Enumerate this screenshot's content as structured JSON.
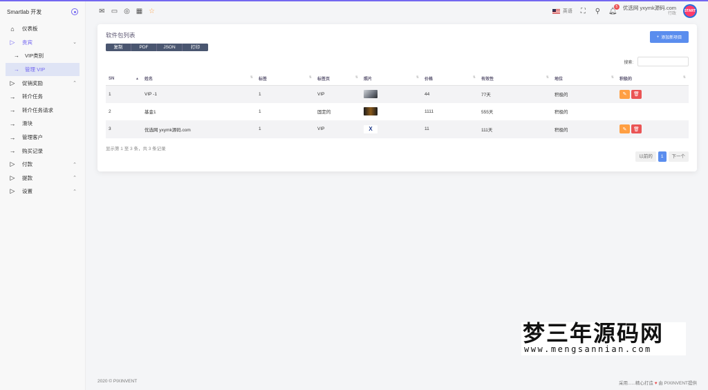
{
  "brand": {
    "name": "Smartlab 开发"
  },
  "sidebar": {
    "items": [
      {
        "icon": "home-icon",
        "glyph": "⌂",
        "label": "仪表板",
        "chev": ""
      },
      {
        "icon": "play-icon",
        "glyph": "▷",
        "label": "贵宾",
        "chev": "⌄"
      },
      {
        "icon": "arrow-icon",
        "glyph": "→",
        "label": "VIP类别",
        "chev": ""
      },
      {
        "icon": "arrow-icon",
        "glyph": "→",
        "label": "管理 VIP",
        "chev": ""
      },
      {
        "icon": "play-icon",
        "glyph": "▷",
        "label": "促销奖励",
        "chev": "⌃"
      },
      {
        "icon": "arrow-icon",
        "glyph": "→",
        "label": "转介任务",
        "chev": ""
      },
      {
        "icon": "arrow-icon",
        "glyph": "→",
        "label": "转介任务请求",
        "chev": ""
      },
      {
        "icon": "arrow-icon",
        "glyph": "→",
        "label": "滑块",
        "chev": ""
      },
      {
        "icon": "arrow-icon",
        "glyph": "→",
        "label": "管理客户",
        "chev": ""
      },
      {
        "icon": "arrow-icon",
        "glyph": "→",
        "label": "购买记录",
        "chev": ""
      },
      {
        "icon": "play-icon",
        "glyph": "▷",
        "label": "付款",
        "chev": "⌃"
      },
      {
        "icon": "play-icon",
        "glyph": "▷",
        "label": "提款",
        "chev": "⌃"
      },
      {
        "icon": "play-icon",
        "glyph": "▷",
        "label": "设置",
        "chev": "⌃"
      }
    ]
  },
  "header": {
    "lang": "英语",
    "notif_count": "5",
    "user_name": "优选网 yxymk源码.com",
    "user_role": "行政",
    "avatar_text": "START"
  },
  "card": {
    "title": "软件包列表",
    "export": [
      "复制",
      "PDF",
      "JSON",
      "打印"
    ],
    "add_label": "添加新项目",
    "search_label": "搜索:",
    "columns": [
      "SN",
      "姓名",
      "标签",
      "标签页",
      "照片",
      "价格",
      "有效性",
      "地位",
      "积极的"
    ],
    "rows": [
      {
        "sn": "1",
        "name": "VIP -1",
        "tag": "1",
        "tab": "VIP",
        "photo": "car",
        "price": "44",
        "validity": "77天",
        "status": "积极的"
      },
      {
        "sn": "2",
        "name": "基金1",
        "tag": "1",
        "tab": "固定的",
        "photo": "dark",
        "price": "1111",
        "validity": "555天",
        "status": "积极的"
      },
      {
        "sn": "3",
        "name": "优选网 yxymk源码.com",
        "tag": "1",
        "tab": "VIP",
        "photo": "logo",
        "price": "11",
        "validity": "111天",
        "status": "积极的"
      }
    ],
    "info": "显示第 1 至 3 条，共 3 条记录",
    "pager": {
      "prev": "以前的",
      "current": "1",
      "next": "下一个"
    }
  },
  "footer": {
    "left": "2020 © PIXINVENT",
    "right_prefix": "采用......精心打造",
    "right_suffix": "由 PIXINVENT提供"
  },
  "watermark": {
    "title": "梦三年源码网",
    "url": "www.mengsannian.com"
  },
  "colors": {
    "accent": "#7367f0",
    "primary_button": "#5a8dee",
    "edit": "#ff9f43",
    "delete": "#ea5455"
  }
}
